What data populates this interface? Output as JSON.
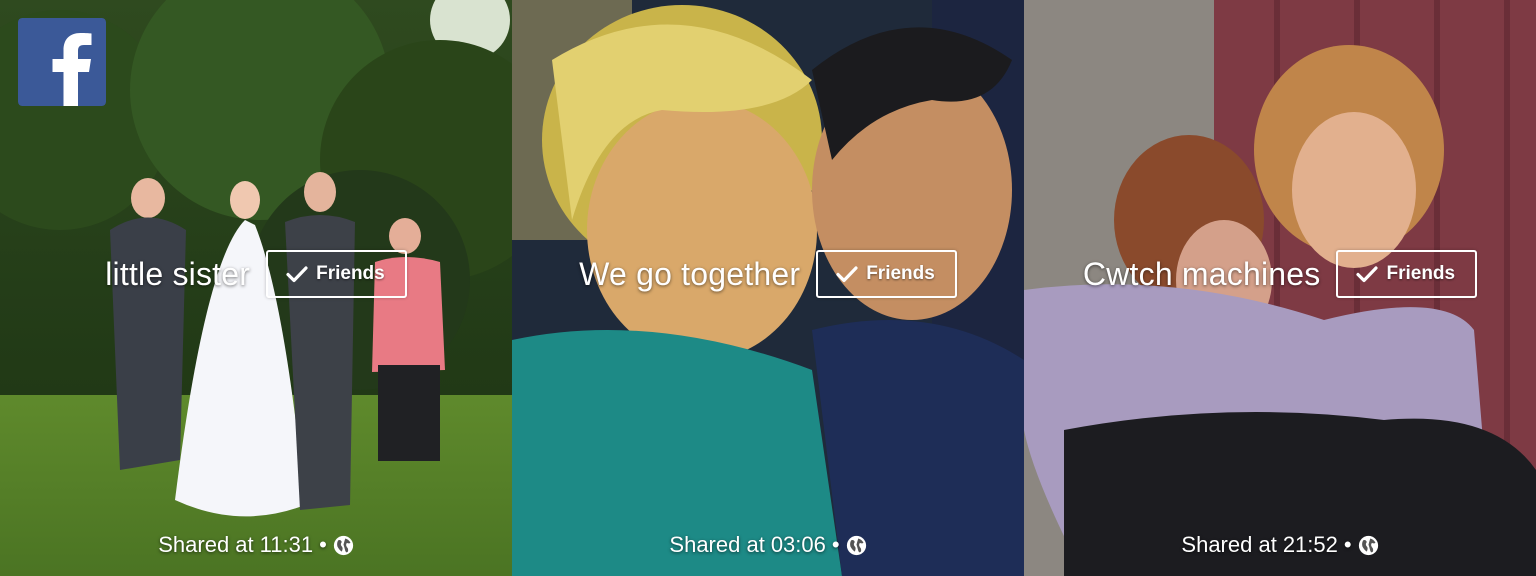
{
  "brand": {
    "icon": "facebook-logo-icon",
    "color": "#3b5998"
  },
  "panels": [
    {
      "caption": "little sister",
      "friends_label": "Friends",
      "shared_prefix": "Shared at",
      "time": "11:31",
      "separator": "•",
      "audience_icon": "globe-icon"
    },
    {
      "caption": "We go together",
      "friends_label": "Friends",
      "shared_prefix": "Shared at",
      "time": "03:06",
      "separator": "•",
      "audience_icon": "globe-icon"
    },
    {
      "caption": "Cwtch machines",
      "friends_label": "Friends",
      "shared_prefix": "Shared at",
      "time": "21:52",
      "separator": "•",
      "audience_icon": "globe-icon"
    }
  ]
}
